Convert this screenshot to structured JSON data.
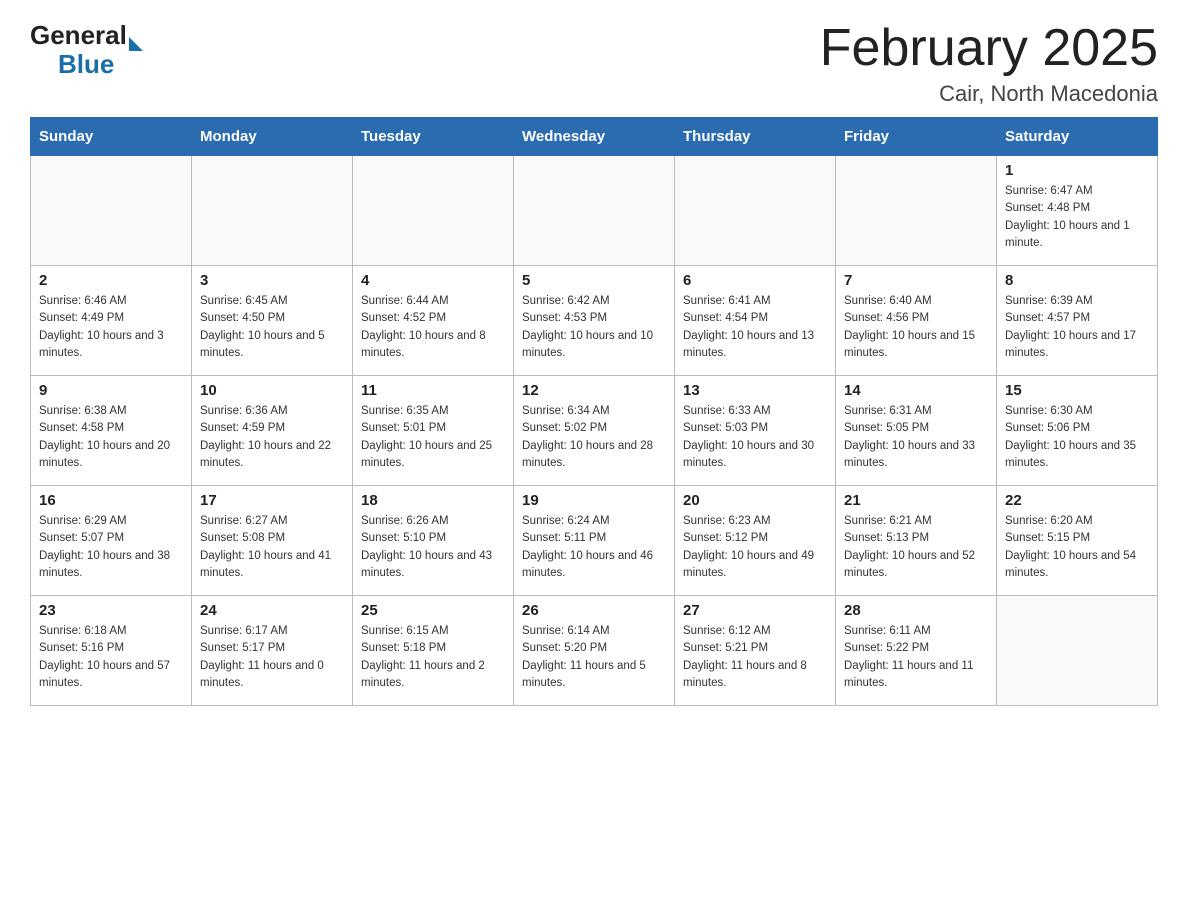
{
  "header": {
    "logo": {
      "general": "General",
      "blue": "Blue"
    },
    "title": "February 2025",
    "location": "Cair, North Macedonia"
  },
  "weekdays": [
    "Sunday",
    "Monday",
    "Tuesday",
    "Wednesday",
    "Thursday",
    "Friday",
    "Saturday"
  ],
  "weeks": [
    [
      {
        "day": "",
        "info": ""
      },
      {
        "day": "",
        "info": ""
      },
      {
        "day": "",
        "info": ""
      },
      {
        "day": "",
        "info": ""
      },
      {
        "day": "",
        "info": ""
      },
      {
        "day": "",
        "info": ""
      },
      {
        "day": "1",
        "info": "Sunrise: 6:47 AM\nSunset: 4:48 PM\nDaylight: 10 hours and 1 minute."
      }
    ],
    [
      {
        "day": "2",
        "info": "Sunrise: 6:46 AM\nSunset: 4:49 PM\nDaylight: 10 hours and 3 minutes."
      },
      {
        "day": "3",
        "info": "Sunrise: 6:45 AM\nSunset: 4:50 PM\nDaylight: 10 hours and 5 minutes."
      },
      {
        "day": "4",
        "info": "Sunrise: 6:44 AM\nSunset: 4:52 PM\nDaylight: 10 hours and 8 minutes."
      },
      {
        "day": "5",
        "info": "Sunrise: 6:42 AM\nSunset: 4:53 PM\nDaylight: 10 hours and 10 minutes."
      },
      {
        "day": "6",
        "info": "Sunrise: 6:41 AM\nSunset: 4:54 PM\nDaylight: 10 hours and 13 minutes."
      },
      {
        "day": "7",
        "info": "Sunrise: 6:40 AM\nSunset: 4:56 PM\nDaylight: 10 hours and 15 minutes."
      },
      {
        "day": "8",
        "info": "Sunrise: 6:39 AM\nSunset: 4:57 PM\nDaylight: 10 hours and 17 minutes."
      }
    ],
    [
      {
        "day": "9",
        "info": "Sunrise: 6:38 AM\nSunset: 4:58 PM\nDaylight: 10 hours and 20 minutes."
      },
      {
        "day": "10",
        "info": "Sunrise: 6:36 AM\nSunset: 4:59 PM\nDaylight: 10 hours and 22 minutes."
      },
      {
        "day": "11",
        "info": "Sunrise: 6:35 AM\nSunset: 5:01 PM\nDaylight: 10 hours and 25 minutes."
      },
      {
        "day": "12",
        "info": "Sunrise: 6:34 AM\nSunset: 5:02 PM\nDaylight: 10 hours and 28 minutes."
      },
      {
        "day": "13",
        "info": "Sunrise: 6:33 AM\nSunset: 5:03 PM\nDaylight: 10 hours and 30 minutes."
      },
      {
        "day": "14",
        "info": "Sunrise: 6:31 AM\nSunset: 5:05 PM\nDaylight: 10 hours and 33 minutes."
      },
      {
        "day": "15",
        "info": "Sunrise: 6:30 AM\nSunset: 5:06 PM\nDaylight: 10 hours and 35 minutes."
      }
    ],
    [
      {
        "day": "16",
        "info": "Sunrise: 6:29 AM\nSunset: 5:07 PM\nDaylight: 10 hours and 38 minutes."
      },
      {
        "day": "17",
        "info": "Sunrise: 6:27 AM\nSunset: 5:08 PM\nDaylight: 10 hours and 41 minutes."
      },
      {
        "day": "18",
        "info": "Sunrise: 6:26 AM\nSunset: 5:10 PM\nDaylight: 10 hours and 43 minutes."
      },
      {
        "day": "19",
        "info": "Sunrise: 6:24 AM\nSunset: 5:11 PM\nDaylight: 10 hours and 46 minutes."
      },
      {
        "day": "20",
        "info": "Sunrise: 6:23 AM\nSunset: 5:12 PM\nDaylight: 10 hours and 49 minutes."
      },
      {
        "day": "21",
        "info": "Sunrise: 6:21 AM\nSunset: 5:13 PM\nDaylight: 10 hours and 52 minutes."
      },
      {
        "day": "22",
        "info": "Sunrise: 6:20 AM\nSunset: 5:15 PM\nDaylight: 10 hours and 54 minutes."
      }
    ],
    [
      {
        "day": "23",
        "info": "Sunrise: 6:18 AM\nSunset: 5:16 PM\nDaylight: 10 hours and 57 minutes."
      },
      {
        "day": "24",
        "info": "Sunrise: 6:17 AM\nSunset: 5:17 PM\nDaylight: 11 hours and 0 minutes."
      },
      {
        "day": "25",
        "info": "Sunrise: 6:15 AM\nSunset: 5:18 PM\nDaylight: 11 hours and 2 minutes."
      },
      {
        "day": "26",
        "info": "Sunrise: 6:14 AM\nSunset: 5:20 PM\nDaylight: 11 hours and 5 minutes."
      },
      {
        "day": "27",
        "info": "Sunrise: 6:12 AM\nSunset: 5:21 PM\nDaylight: 11 hours and 8 minutes."
      },
      {
        "day": "28",
        "info": "Sunrise: 6:11 AM\nSunset: 5:22 PM\nDaylight: 11 hours and 11 minutes."
      },
      {
        "day": "",
        "info": ""
      }
    ]
  ]
}
